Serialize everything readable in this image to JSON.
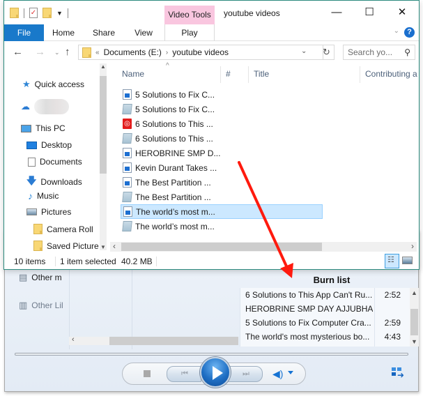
{
  "explorer": {
    "window_title": "youtube videos",
    "context_tab": "Video Tools",
    "ribbon_tabs": [
      {
        "label": "File"
      },
      {
        "label": "Home"
      },
      {
        "label": "Share"
      },
      {
        "label": "View"
      },
      {
        "label": "Play"
      }
    ],
    "window_controls": {
      "minimize": "—",
      "maximize": "☐",
      "close": "✕"
    },
    "help_label": "?",
    "address": {
      "overflow": "«",
      "crumbs": [
        "Documents (E:)",
        "youtube videos"
      ],
      "separator": "›"
    },
    "search_placeholder": "Search yo...",
    "nav_pane": {
      "quick_access": "Quick access",
      "onedrive_label_blurred": "",
      "this_pc": "This PC",
      "items": [
        {
          "label": "Desktop"
        },
        {
          "label": "Documents"
        },
        {
          "label": "Downloads"
        },
        {
          "label": "Music"
        },
        {
          "label": "Pictures"
        },
        {
          "label": "Camera Roll"
        },
        {
          "label": "Saved Picture"
        }
      ]
    },
    "columns": [
      "Name",
      "#",
      "Title",
      "Contributing a"
    ],
    "files": [
      {
        "name": "5 Solutions to Fix C...",
        "type": "video",
        "selected": false
      },
      {
        "name": "5 Solutions to Fix C...",
        "type": "text",
        "selected": false
      },
      {
        "name": "6 Solutions to This ...",
        "type": "app",
        "selected": false
      },
      {
        "name": "6 Solutions to This ...",
        "type": "text",
        "selected": false
      },
      {
        "name": "HEROBRINE SMP D...",
        "type": "video",
        "selected": false
      },
      {
        "name": "Kevin Durant Takes ...",
        "type": "video",
        "selected": false
      },
      {
        "name": "The Best Partition ...",
        "type": "video",
        "selected": false
      },
      {
        "name": "The Best Partition ...",
        "type": "text",
        "selected": false
      },
      {
        "name": "The world’s most m...",
        "type": "video",
        "selected": true
      },
      {
        "name": "The world’s most m...",
        "type": "text",
        "selected": false
      }
    ],
    "status": {
      "item_count": "10 items",
      "selection": "1 item selected",
      "size": "40.2 MB"
    },
    "colors": {
      "border": "#2b8a7e",
      "file_tab": "#1979ca",
      "context_tab": "#f9c6df",
      "selection": "#cce8ff"
    }
  },
  "wmp": {
    "nav_items": [
      {
        "label": "Other m"
      },
      {
        "label": "Other Lil"
      }
    ],
    "burn_list": {
      "title": "Burn list",
      "items": [
        {
          "title": "6 Solutions to This App Can't Ru...",
          "duration": "2:52"
        },
        {
          "title": "HEROBRINE SMP DAY AJJUBHAI...",
          "duration": ""
        },
        {
          "title": "5 Solutions to Fix Computer Cra...",
          "duration": "2:59"
        },
        {
          "title": "The world's most mysterious bo...",
          "duration": "4:43"
        }
      ]
    },
    "controls": {
      "prev": "⏮",
      "next": "⏭",
      "volume": "🔊"
    }
  },
  "annotation": {
    "type": "arrow",
    "color": "#ff1a0e"
  }
}
